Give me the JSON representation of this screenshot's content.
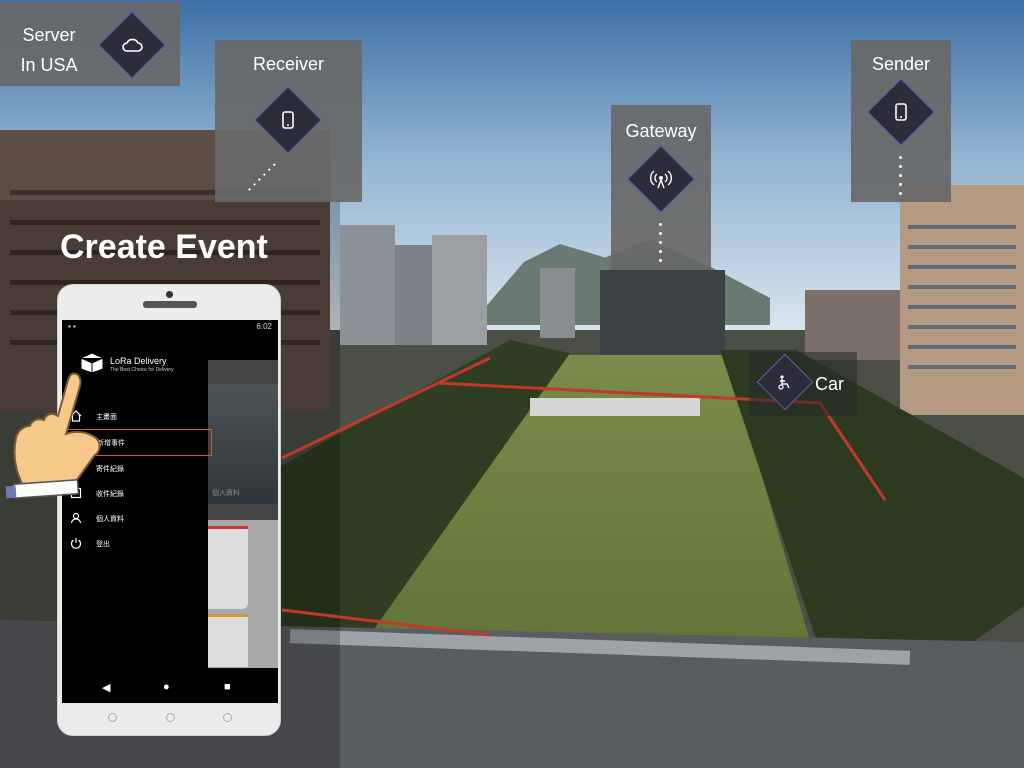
{
  "callouts": {
    "server": {
      "line1": "Server",
      "line2": "In USA",
      "icon": "cloud-icon"
    },
    "receiver": {
      "label": "Receiver",
      "icon": "phone-icon"
    },
    "gateway": {
      "label": "Gateway",
      "icon": "antenna-icon"
    },
    "sender": {
      "label": "Sender",
      "icon": "phone-icon"
    },
    "car": {
      "label": "Car",
      "icon": "delivery-icon"
    }
  },
  "title": "Create Event",
  "phone": {
    "status_time": "6:02",
    "app_name": "LoRa Delivery",
    "app_tagline": "The Best Choice for Delivery",
    "menu": [
      {
        "label": "主畫面",
        "icon": "home-icon",
        "active": false
      },
      {
        "label": "新增事件",
        "icon": "add-event-icon",
        "active": true
      },
      {
        "label": "寄件紀錄",
        "icon": "send-record-icon",
        "active": false
      },
      {
        "label": "收件紀錄",
        "icon": "receive-record-icon",
        "active": false
      },
      {
        "label": "個人資料",
        "icon": "person-icon",
        "active": false
      },
      {
        "label": "登出",
        "icon": "power-icon",
        "active": false
      }
    ],
    "background_card_caption": "個人資料",
    "nav": {
      "back": "◀",
      "home": "●",
      "recent": "■"
    }
  },
  "colors": {
    "route": "#c0392b",
    "callout_bg": "#686868",
    "diamond": "#2c2c3a",
    "highlight": "#e0552a"
  }
}
